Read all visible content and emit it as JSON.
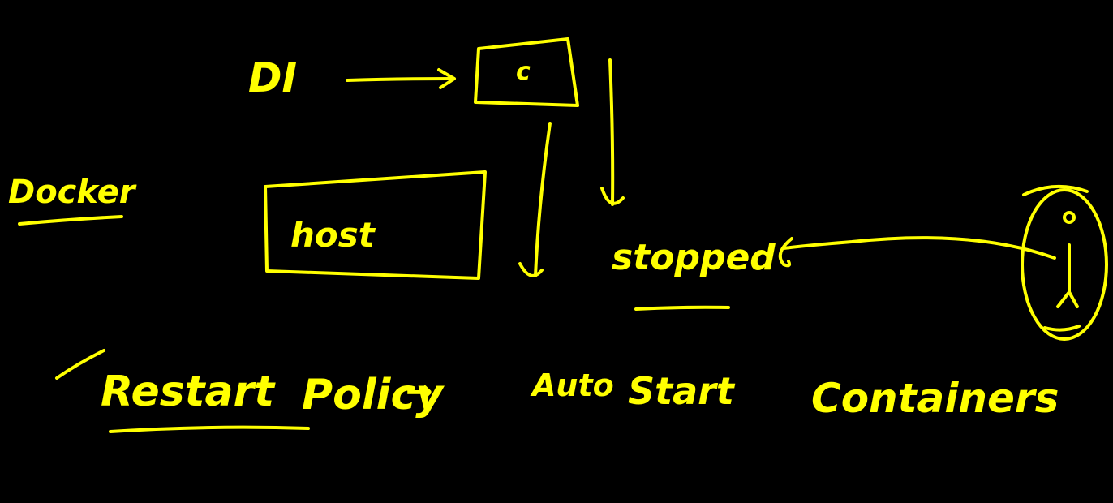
{
  "colors": {
    "background": "#000000",
    "ink": "#ffff00"
  },
  "labels": {
    "di": "DI",
    "container": "c",
    "docker": "Docker",
    "host": "host",
    "stopped": "stopped",
    "restart": "Restart",
    "policy": "Policy",
    "arrow": "→",
    "auto": "Auto",
    "start": "Start",
    "containers": "Containers"
  },
  "icons": {
    "checkmark": "checkmark-icon",
    "person": "person-icon"
  }
}
